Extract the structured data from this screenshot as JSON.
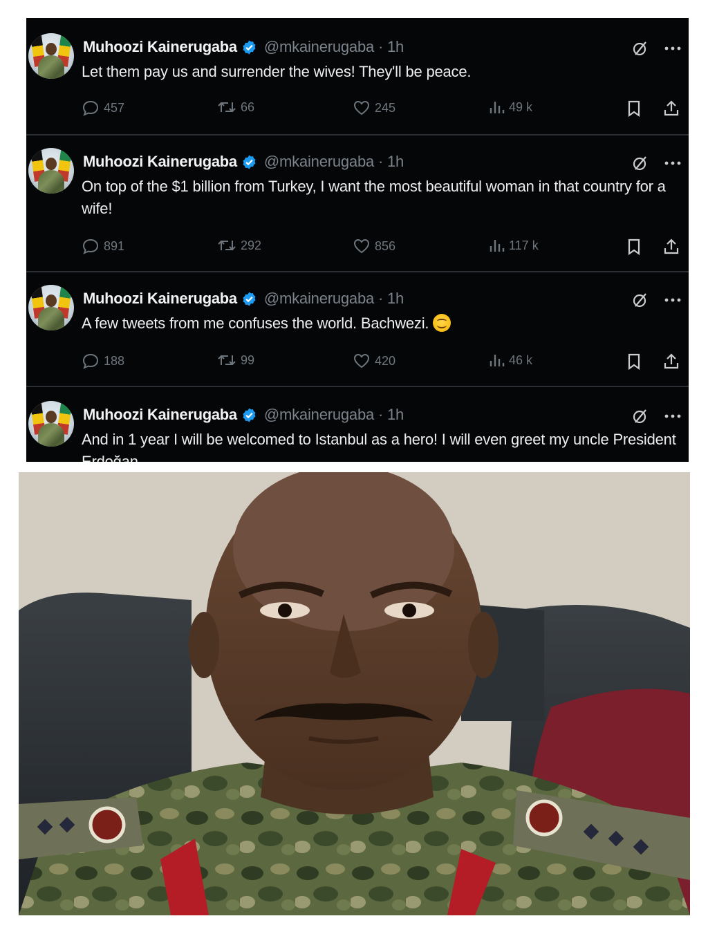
{
  "tweets": [
    {
      "name": "Muhoozi Kainerugaba",
      "handle_time": "@mkainerugaba · 1h",
      "text": "Let them pay us and surrender the wives! They'll be peace.",
      "replies": "457",
      "retweets": "66",
      "likes": "245",
      "views": "49 k"
    },
    {
      "name": "Muhoozi Kainerugaba",
      "handle_time": "@mkainerugaba · 1h",
      "text": "On top of the $1 billion from Turkey, I want the most beautiful woman in that country for a wife!",
      "replies": "891",
      "retweets": "292",
      "likes": "856",
      "views": "117 k"
    },
    {
      "name": "Muhoozi Kainerugaba",
      "handle_time": "@mkainerugaba · 1h",
      "text": "A few tweets from me confuses the world. Bachwezi.",
      "replies": "188",
      "retweets": "99",
      "likes": "420",
      "views": "46 k"
    },
    {
      "name": "Muhoozi Kainerugaba",
      "handle_time": "@mkainerugaba · 1h",
      "text": "And in 1 year I will be welcomed to Istanbul as a hero! I will even greet my uncle President Erdoğan"
    }
  ],
  "colors": {
    "background": "#050607",
    "text": "#eceeef",
    "muted": "#6e767d",
    "verified": "#1d9bf0"
  },
  "icons": [
    "verified-icon",
    "grok-icon",
    "more-icon",
    "reply-icon",
    "retweet-icon",
    "like-icon",
    "views-icon",
    "bookmark-icon",
    "share-icon",
    "smiling-emoji"
  ]
}
